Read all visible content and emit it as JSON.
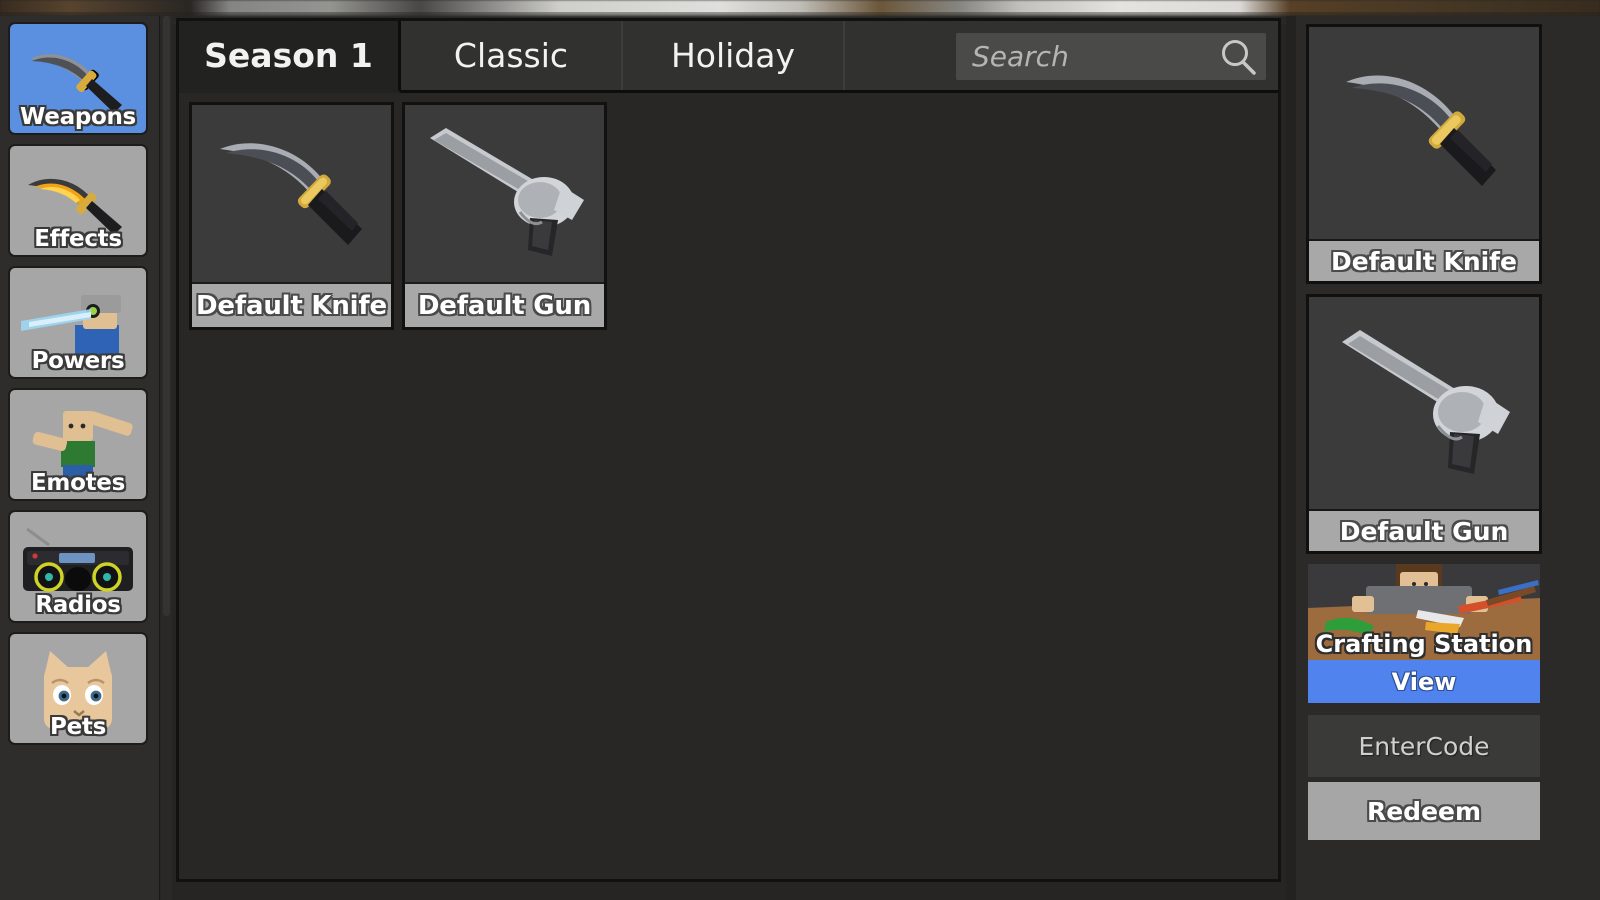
{
  "sidebar": {
    "items": [
      {
        "label": "Weapons",
        "icon": "knife-icon",
        "active": true
      },
      {
        "label": "Effects",
        "icon": "flame-knife-icon",
        "active": false
      },
      {
        "label": "Powers",
        "icon": "power-character-icon",
        "active": false
      },
      {
        "label": "Emotes",
        "icon": "dab-character-icon",
        "active": false
      },
      {
        "label": "Radios",
        "icon": "boombox-icon",
        "active": false
      },
      {
        "label": "Pets",
        "icon": "cat-head-icon",
        "active": false
      }
    ]
  },
  "main": {
    "tabs": [
      {
        "label": "Season 1",
        "active": true
      },
      {
        "label": "Classic",
        "active": false
      },
      {
        "label": "Holiday",
        "active": false
      }
    ],
    "search": {
      "placeholder": "Search",
      "value": "",
      "icon": "search-icon"
    },
    "items": [
      {
        "name": "Default Knife",
        "icon": "knife-icon"
      },
      {
        "name": "Default Gun",
        "icon": "revolver-icon"
      }
    ]
  },
  "right_panel": {
    "equipped": [
      {
        "name": "Default Knife",
        "icon": "knife-icon"
      },
      {
        "name": "Default Gun",
        "icon": "revolver-icon"
      }
    ],
    "crafting": {
      "label": "Crafting Station",
      "view_label": "View",
      "icon": "crafting-table-icon"
    },
    "code": {
      "placeholder": "EnterCode",
      "value": "",
      "redeem_label": "Redeem"
    }
  },
  "colors": {
    "accent_blue": "#5083ee",
    "sidebar_active_blue": "#5b8fe0",
    "panel_bg": "#282726",
    "card_label_gray": "#a8a8a8",
    "redeem_gray": "#a6a6a6"
  }
}
